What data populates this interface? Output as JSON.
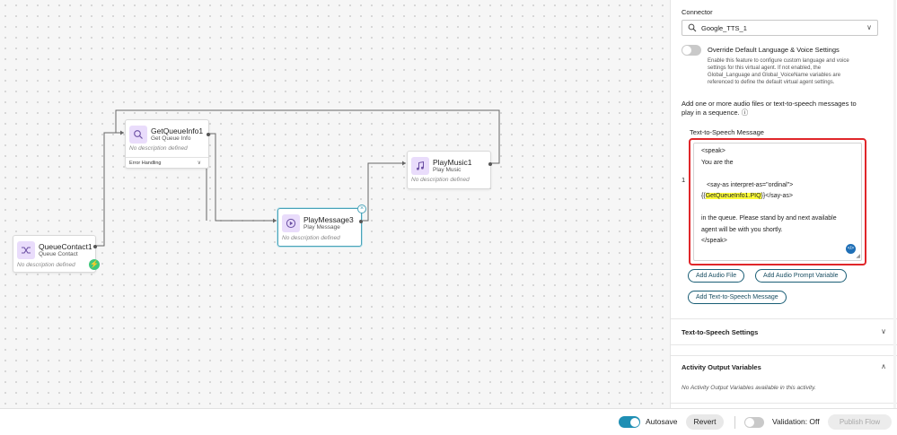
{
  "canvas": {
    "nodes": {
      "queue_contact": {
        "title": "QueueContact1",
        "subtitle": "Queue Contact",
        "description": "No description defined",
        "icon": "shuffle-icon"
      },
      "get_queue_info": {
        "title": "GetQueueInfo1",
        "subtitle": "Get Queue Info",
        "description": "No description defined",
        "footer": "Error Handling",
        "icon": "search-icon"
      },
      "play_message": {
        "title": "PlayMessage3",
        "subtitle": "Play Message",
        "description": "No description defined",
        "icon": "play-icon"
      },
      "play_music": {
        "title": "PlayMusic1",
        "subtitle": "Play Music",
        "description": "No description defined",
        "icon": "music-note-icon"
      }
    }
  },
  "panel": {
    "connector_label": "Connector",
    "connector_value": "Google_TTS_1",
    "override_label": "Override Default Language & Voice Settings",
    "override_help": [
      "Enable this feature to configure custom language and voice",
      "settings for this virtual agent. If not enabled, the",
      "Global_Language and Global_VoiceName variables are",
      "referenced to define the default virtual agent settings."
    ],
    "add_instructions": [
      "Add one or more audio files or text-to-speech messages to",
      "play in a sequence."
    ],
    "info_glyph": "ⓘ",
    "tts_label": "Text-to-Speech Message",
    "row_index": "1",
    "tts_lines": {
      "l1": "<speak>",
      "l2": "You are the",
      "l3": "<say-as interpret-as=\"ordinal\">",
      "l4_pre": "{{",
      "l4_hl": "GetQueueInfo1.PIQ",
      "l4_post": "}}</say-as>",
      "l5": "in the queue. Please stand by and next available",
      "l6": "agent will be with you shortly.",
      "l7": "</speak>"
    },
    "buttons": {
      "add_audio_file": "Add Audio File",
      "add_audio_prompt_variable": "Add Audio Prompt Variable",
      "add_tts_message": "Add Text-to-Speech Message"
    },
    "tts_settings_title": "Text-to-Speech Settings",
    "activity_output_title": "Activity Output Variables",
    "activity_output_empty": "No Activity Output Variables available in this activity."
  },
  "footer": {
    "autosave_label": "Autosave",
    "revert_label": "Revert",
    "validation_label": "Validation: Off",
    "publish_label": "Publish Flow"
  },
  "colors": {
    "accent": "#1f8fb4",
    "highlight_border": "#e0262a",
    "node_icon_bg": "#e9dcfb",
    "selected_node_border": "#4aa3b8"
  }
}
